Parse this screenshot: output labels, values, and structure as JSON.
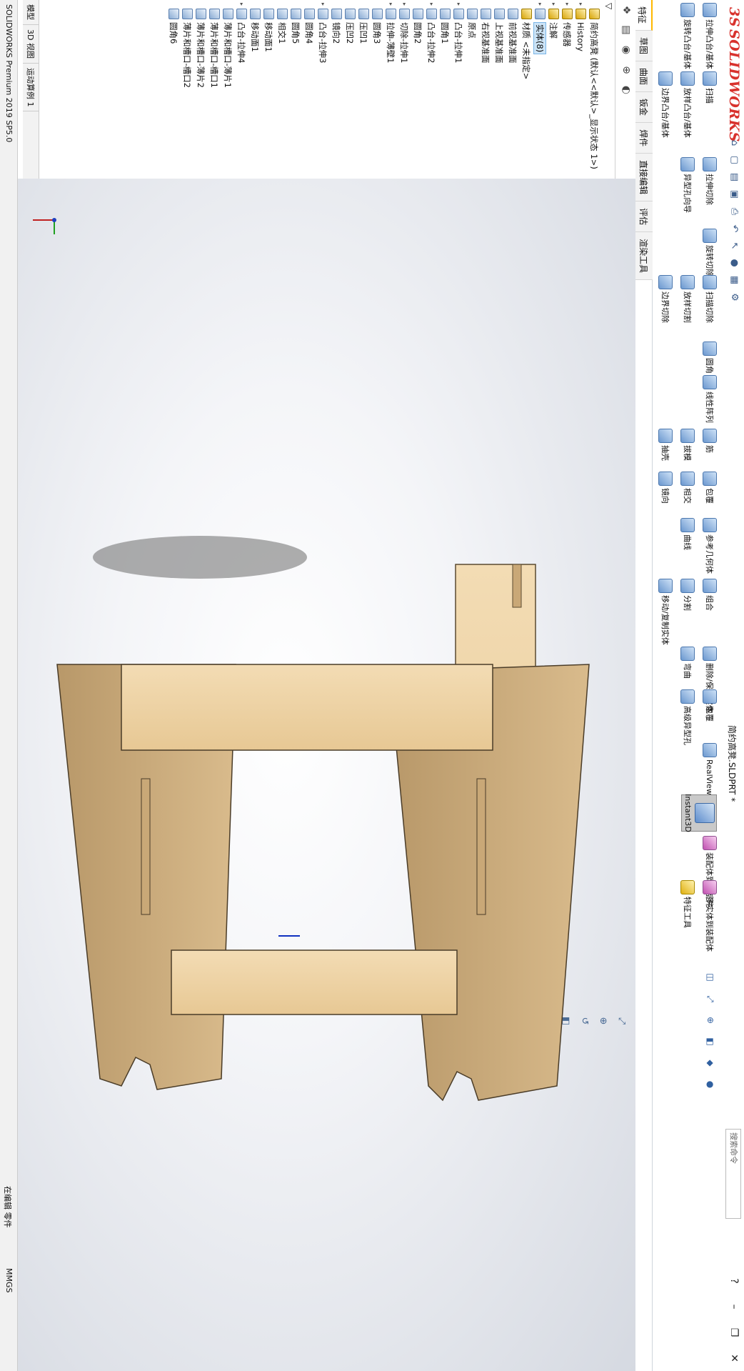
{
  "app": {
    "brand": "SOLIDWORKS",
    "document_title": "简约高凳.SLDPRT *",
    "search_placeholder": "搜索命令",
    "help": "?"
  },
  "commands": {
    "extrude_boss": "拉伸凸台/基体",
    "revolve_boss": "旋转凸台/基体",
    "sweep": "扫描",
    "loft": "放样凸台/基体",
    "boundary_boss": "边界凸台/基体",
    "extrude_cut": "拉伸切除",
    "hole_wizard": "异型孔向导",
    "revolve_cut": "旋转切除",
    "sweep_cut": "扫描切除",
    "loft_cut": "放样切割",
    "boundary_cut": "边界切除",
    "fillet": "圆角",
    "linear_pattern": "线性阵列",
    "rib": "筋",
    "draft": "拔模",
    "shell": "抽壳",
    "wrap": "包覆",
    "intersect": "相交",
    "mirror": "镜向",
    "ref_geometry": "参考几何体",
    "curves": "曲线",
    "combine": "组合",
    "split": "分割",
    "move_copy": "移动/复制实体",
    "delete_body": "删除/保留实体",
    "flex": "弯曲",
    "wrap2": "包覆",
    "draft_hole": "高级异型孔",
    "realview": "RealView 图形",
    "instant3d": "Instant3D",
    "assembly_body": "装配体到零部件",
    "multibody": "多实体到装配体",
    "feature_tools": "特征工具"
  },
  "tabs": [
    "特征",
    "草图",
    "曲面",
    "钣金",
    "焊件",
    "直接编辑",
    "评估",
    "渲染工具"
  ],
  "tree": {
    "root": "简约高凳 (默认<<默认>_显示状态 1>)",
    "items": [
      "History",
      "传感器",
      "注解",
      "实体(8)",
      "材质 <未指定>",
      "前视基准面",
      "上视基准面",
      "右视基准面",
      "原点",
      "凸台-拉伸1",
      "圆角1",
      "凸台-拉伸2",
      "圆角2",
      "切除-拉伸1",
      "拉伸-薄壁1",
      "圆角3",
      "压凹1",
      "压凹2",
      "镜向2",
      "凸台-拉伸3",
      "圆角4",
      "圆角5",
      "相交1",
      "移动面1",
      "移动面1",
      "凸台-拉伸4",
      "薄片和槽口-薄片1",
      "薄片和槽口-槽口1",
      "薄片和槽口-薄片2",
      "薄片和槽口-槽口2",
      "圆角6"
    ]
  },
  "model_tabs": [
    "模型",
    "3D 视图",
    "运动算例 1"
  ],
  "status": {
    "version": "SOLIDWORKS Premium 2019 SP5.0",
    "mode": "在编辑 零件",
    "units": "MMGS"
  }
}
